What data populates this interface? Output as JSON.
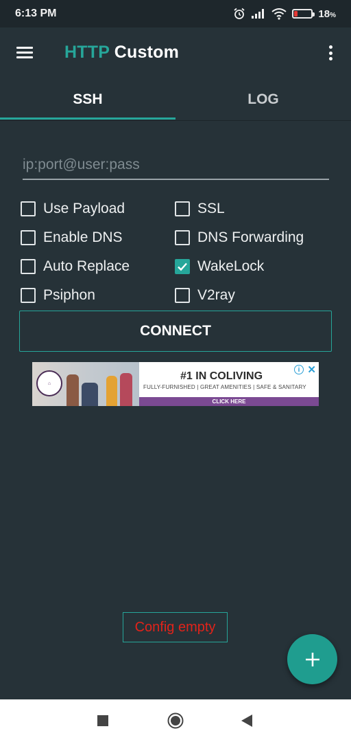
{
  "status_bar": {
    "time": "6:13 PM",
    "icons": [
      "alarm-icon",
      "signal-icon",
      "wifi-icon",
      "battery-icon"
    ],
    "battery_level_percent": 18,
    "battery_text": "18",
    "battery_unit": "%"
  },
  "app_bar": {
    "title_part1": "HTTP",
    "title_part2": "Custom",
    "menu_icon": "hamburger-menu-icon",
    "overflow_icon": "more-vertical-icon"
  },
  "tabs": [
    {
      "label": "SSH",
      "active": true
    },
    {
      "label": "LOG",
      "active": false
    }
  ],
  "server_input": {
    "placeholder": "ip:port@user:pass",
    "value": ""
  },
  "options": [
    {
      "label": "Use Payload",
      "checked": false
    },
    {
      "label": "SSL",
      "checked": false
    },
    {
      "label": "Enable DNS",
      "checked": false
    },
    {
      "label": "DNS Forwarding",
      "checked": false
    },
    {
      "label": "Auto Replace",
      "checked": false
    },
    {
      "label": "WakeLock",
      "checked": true
    },
    {
      "label": "Psiphon",
      "checked": false
    },
    {
      "label": "V2ray",
      "checked": false
    }
  ],
  "connect_label": "CONNECT",
  "ad": {
    "headline": "#1 IN COLIVING",
    "subline": "FULLY-FURNISHED  |  GREAT AMENITIES  |  SAFE & SANITARY",
    "cta": "CLICK HERE",
    "info_icon": "ad-info-icon",
    "close_icon": "ad-close-icon"
  },
  "config_status": "Config empty",
  "fab_icon": "plus-icon",
  "colors": {
    "background": "#263238",
    "accent": "#26a69a",
    "error_text": "#e2231a"
  },
  "nav_bar": {
    "icons": [
      "recents-square-icon",
      "home-circle-icon",
      "back-triangle-icon"
    ]
  }
}
